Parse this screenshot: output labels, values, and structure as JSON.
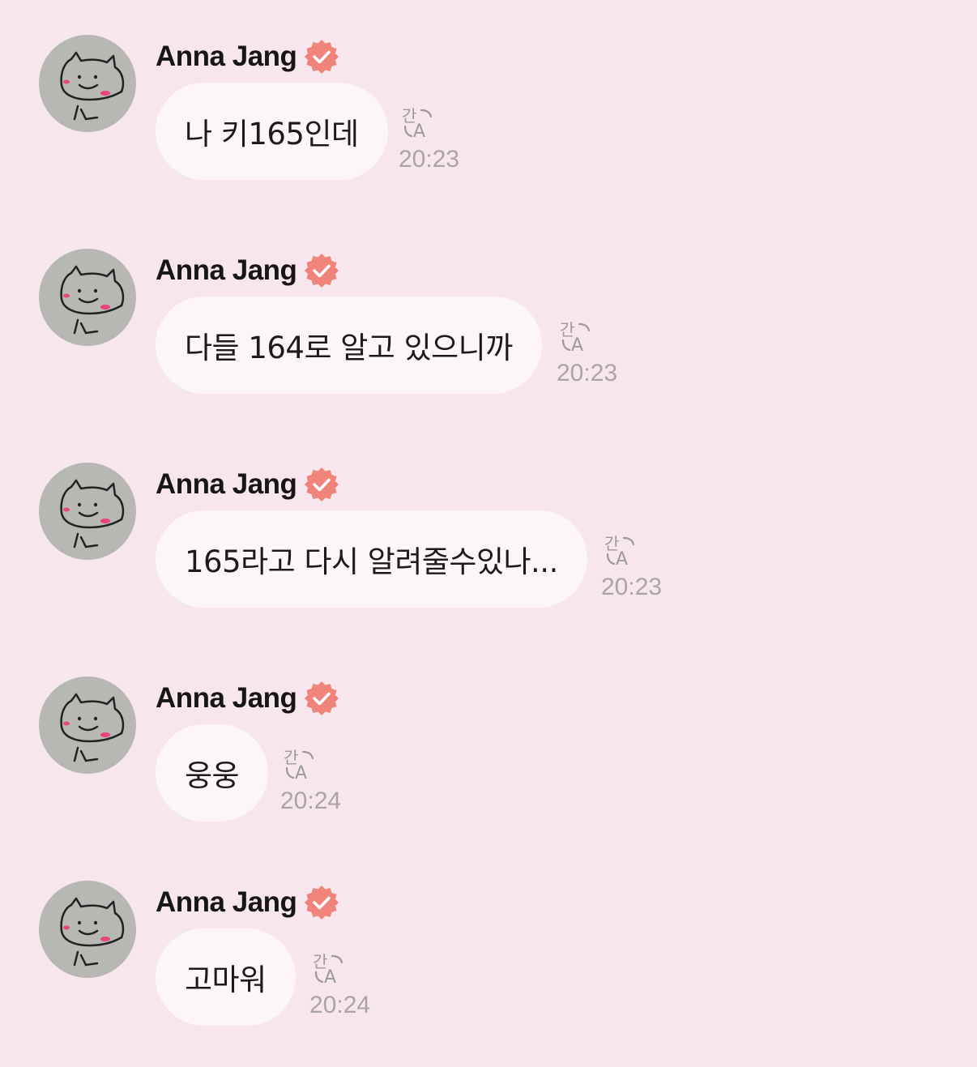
{
  "colors": {
    "background": "#f7e6ee",
    "bubble": "#fdf6f9",
    "badge": "#f0847a",
    "timestamp": "#a9a5a7"
  },
  "icons": {
    "verified": "verified-badge-icon",
    "translate": "translate-icon",
    "avatar": "doodle-cat-avatar"
  },
  "translate_glyph": "간A",
  "messages": [
    {
      "sender": "Anna Jang",
      "text": "나 키165인데",
      "time": "20:23"
    },
    {
      "sender": "Anna Jang",
      "text": "다들 164로 알고 있으니까",
      "time": "20:23"
    },
    {
      "sender": "Anna Jang",
      "text": "165라고 다시 알려줄수있나...",
      "time": "20:23"
    },
    {
      "sender": "Anna Jang",
      "text": "웅웅",
      "time": "20:24"
    },
    {
      "sender": "Anna Jang",
      "text": "고마워",
      "time": "20:24"
    }
  ]
}
